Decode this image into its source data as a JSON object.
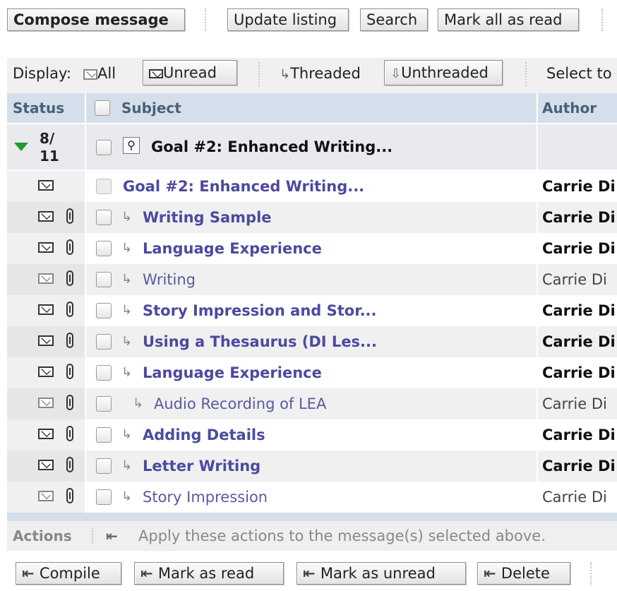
{
  "toolbar": {
    "compose_label": "Compose message",
    "update_label": "Update listing",
    "search_label": "Search",
    "mark_all_label": "Mark all as read"
  },
  "display": {
    "label": "Display:",
    "all_label": "All",
    "unread_label": "Unread",
    "threaded_label": "Threaded",
    "unthreaded_label": "Unthreaded",
    "select_label": "Select to"
  },
  "table": {
    "headers": {
      "status": "Status",
      "subject": "Subject",
      "author": "Author"
    },
    "thread": {
      "count_top": "8/",
      "count_bottom": "11",
      "subject": "Goal #2: Enhanced Writing..."
    },
    "rows": [
      {
        "subject": "Goal #2: Enhanced Writing...",
        "author": "Carrie Di",
        "unread": true,
        "attachment": false,
        "indent": 0,
        "reply": false
      },
      {
        "subject": "Writing Sample",
        "author": "Carrie Di",
        "unread": true,
        "attachment": true,
        "indent": 1,
        "reply": true
      },
      {
        "subject": "Language Experience",
        "author": "Carrie Di",
        "unread": true,
        "attachment": true,
        "indent": 1,
        "reply": true
      },
      {
        "subject": "Writing",
        "author": "Carrie Di",
        "unread": false,
        "attachment": true,
        "indent": 1,
        "reply": true
      },
      {
        "subject": "Story Impression and Stor...",
        "author": "Carrie Di",
        "unread": true,
        "attachment": true,
        "indent": 1,
        "reply": true
      },
      {
        "subject": "Using a Thesaurus (DI Les...",
        "author": "Carrie Di",
        "unread": true,
        "attachment": true,
        "indent": 1,
        "reply": true
      },
      {
        "subject": "Language Experience",
        "author": "Carrie Di",
        "unread": true,
        "attachment": true,
        "indent": 1,
        "reply": true
      },
      {
        "subject": "Audio Recording of LEA",
        "author": "Carrie Di",
        "unread": false,
        "attachment": true,
        "indent": 2,
        "reply": true
      },
      {
        "subject": "Adding Details",
        "author": "Carrie Di",
        "unread": true,
        "attachment": true,
        "indent": 1,
        "reply": true
      },
      {
        "subject": "Letter Writing",
        "author": "Carrie Di",
        "unread": true,
        "attachment": true,
        "indent": 1,
        "reply": true
      },
      {
        "subject": "Story Impression",
        "author": "Carrie Di",
        "unread": false,
        "attachment": true,
        "indent": 1,
        "reply": true
      }
    ]
  },
  "actions": {
    "label": "Actions",
    "hint": "Apply these actions to the message(s) selected above.",
    "compile_label": "Compile",
    "mark_read_label": "Mark as read",
    "mark_unread_label": "Mark as unread",
    "delete_label": "Delete"
  },
  "colors": {
    "header_bg": "#d5dfeb",
    "header_text": "#4a6075",
    "link": "#4c4a9e",
    "thread_bg": "#e9e9ee",
    "expand_arrow": "#1e9a2a"
  },
  "icons": [
    "envelope-closed-icon",
    "envelope-open-icon",
    "paperclip-icon",
    "reply-arrow-icon",
    "magnifier-icon",
    "expand-triangle-icon",
    "apply-action-icon"
  ]
}
